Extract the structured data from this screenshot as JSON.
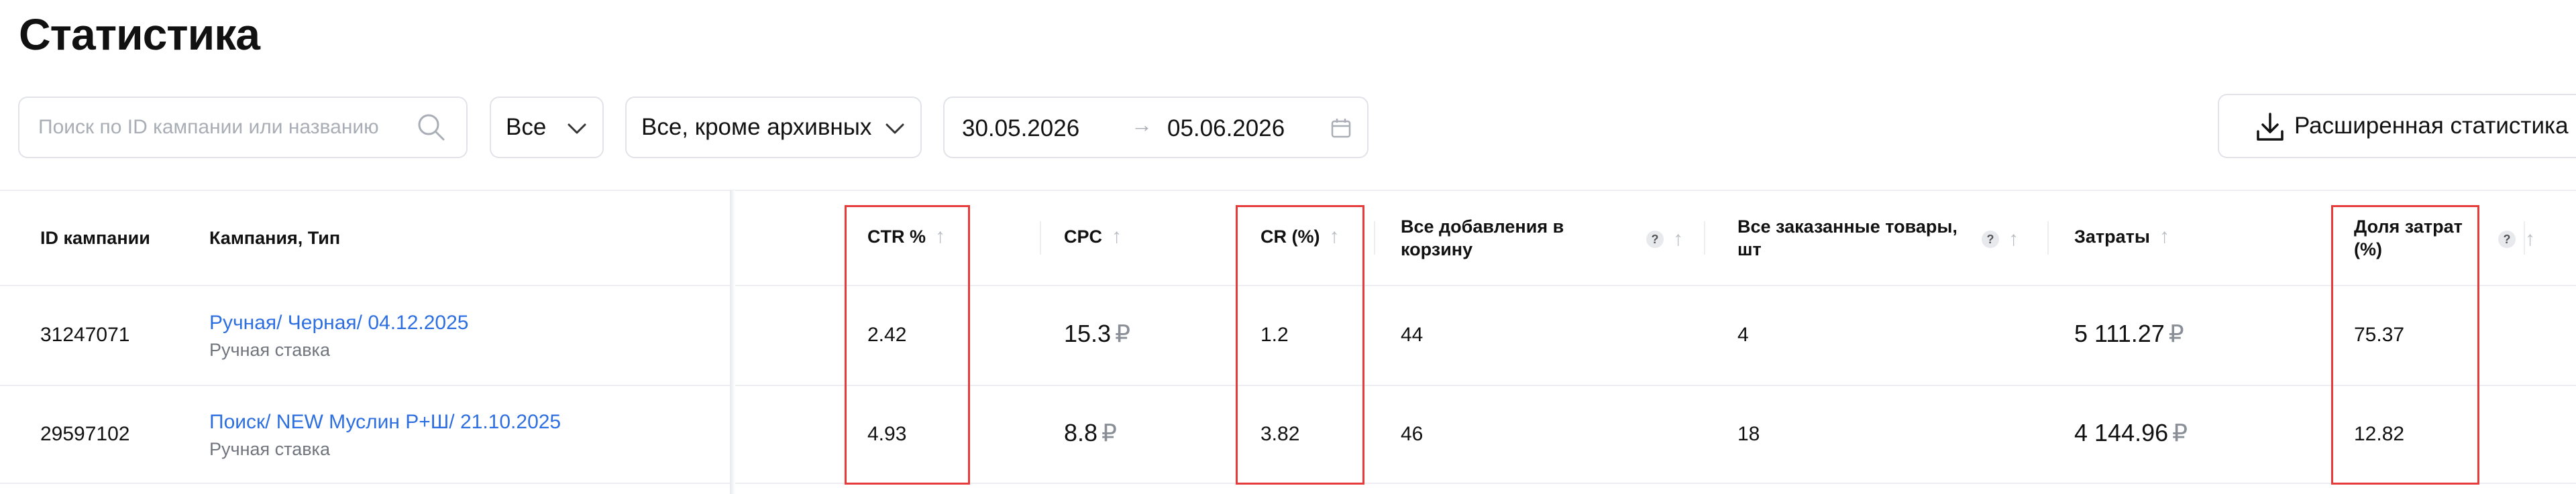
{
  "page": {
    "title": "Статистика"
  },
  "filters": {
    "search_placeholder": "Поиск по ID кампании или названию",
    "type_select": "Все",
    "status_select": "Все, кроме архивных",
    "date_from": "30.05.2026",
    "date_arrow": "→",
    "date_to": "05.06.2026",
    "extended_stats_label": "Расширенная статистика"
  },
  "table": {
    "headers": {
      "id": "ID кампании",
      "campaign": "Кампания, Тип",
      "ctr": "CTR %",
      "cpc": "CPC",
      "cr": "CR (%)",
      "cart_line1": "Все добавления в",
      "cart_line2": "корзину",
      "ordered_line1": "Все заказанные товары,",
      "ordered_line2": "шт",
      "costs": "Затраты",
      "share_line1": "Доля затрат",
      "share_line2": "(%)",
      "help": "?",
      "sort": "↑"
    },
    "rows": [
      {
        "id": "31247071",
        "name": "Ручная/ Черная/ 04.12.2025",
        "type": "Ручная ставка",
        "ctr": "2.42",
        "cpc": "15.3",
        "cr": "1.2",
        "cart": "44",
        "ordered": "4",
        "costs": "5 111.27",
        "share": "75.37"
      },
      {
        "id": "29597102",
        "name": "Поиск/ NEW Муслин Р+Ш/ 21.10.2025",
        "type": "Ручная ставка",
        "ctr": "4.93",
        "cpc": "8.8",
        "cr": "3.82",
        "cart": "46",
        "ordered": "18",
        "costs": "4 144.96",
        "share": "12.82"
      }
    ],
    "currency": "₽"
  },
  "colors": {
    "link": "#2d6fe0",
    "highlight": "#e53b3b",
    "border": "#e1e3e8"
  }
}
